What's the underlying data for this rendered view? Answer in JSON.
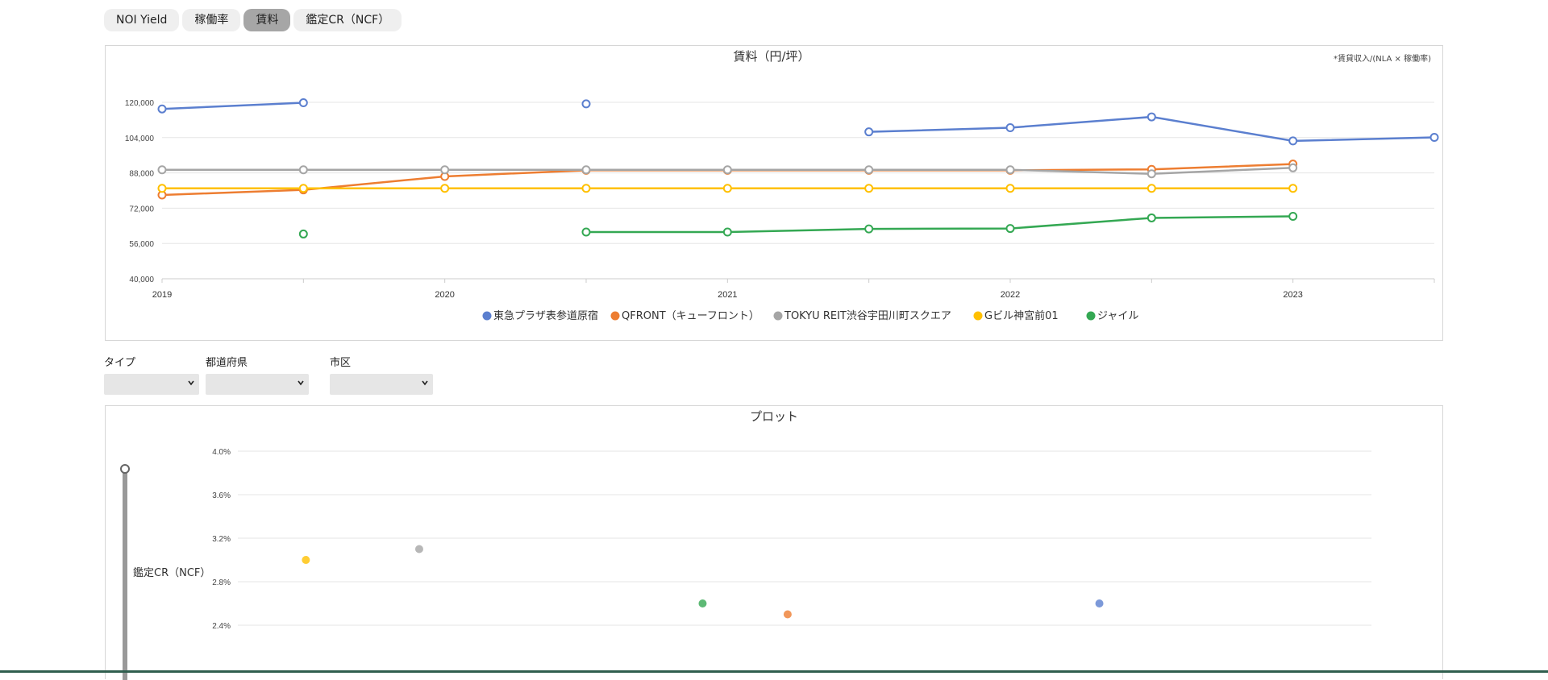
{
  "tabs": [
    {
      "label": "NOI Yield",
      "active": false
    },
    {
      "label": "稼働率",
      "active": false
    },
    {
      "label": "賃料",
      "active": true
    },
    {
      "label": "鑑定CR（NCF）",
      "active": false
    }
  ],
  "filters": {
    "type_label": "タイプ",
    "prefecture_label": "都道府県",
    "city_label": "市区"
  },
  "colors": {
    "blue": "#5b7fcf",
    "orange": "#ed7d31",
    "gray": "#a5a5a5",
    "yellow": "#ffc000",
    "green": "#34a853"
  },
  "chart_data": [
    {
      "type": "line",
      "title": "賃料（円/坪）",
      "note": "*賃貸収入/(NLA × 稼働率)",
      "x_ticks": [
        "2019",
        "2020",
        "2021",
        "2022",
        "2023"
      ],
      "xlim": [
        2019,
        2023.5
      ],
      "ylim": [
        40000,
        120000
      ],
      "y_ticks": [
        40000,
        56000,
        72000,
        88000,
        104000,
        120000
      ],
      "y_tick_labels": [
        "40,000",
        "56,000",
        "72,000",
        "88,000",
        "104,000",
        "120,000"
      ],
      "grid": true,
      "legend_position": "bottom",
      "series": [
        {
          "name": "東急プラザ表参道原宿",
          "color": "#5b7fcf",
          "points": [
            [
              2019,
              117000
            ],
            [
              2019.5,
              119800
            ],
            [
              2020.5,
              119300
            ],
            [
              2021.5,
              106600
            ],
            [
              2022,
              108500
            ],
            [
              2022.5,
              113400
            ],
            [
              2023,
              102500
            ],
            [
              2023.5,
              104100
            ]
          ],
          "breaks_after": [
            1,
            2
          ]
        },
        {
          "name": "QFRONT（キューフロント）",
          "color": "#ed7d31",
          "points": [
            [
              2019,
              78000
            ],
            [
              2019.5,
              80300
            ],
            [
              2020,
              86400
            ],
            [
              2020.5,
              89200
            ],
            [
              2021,
              89200
            ],
            [
              2021.5,
              89200
            ],
            [
              2022,
              89200
            ],
            [
              2022.5,
              89600
            ],
            [
              2023,
              92000
            ]
          ],
          "breaks_after": []
        },
        {
          "name": "TOKYU REIT渋谷宇田川町スクエア",
          "color": "#a5a5a5",
          "points": [
            [
              2019,
              89400
            ],
            [
              2019.5,
              89400
            ],
            [
              2020,
              89400
            ],
            [
              2020.5,
              89400
            ],
            [
              2021,
              89400
            ],
            [
              2021.5,
              89400
            ],
            [
              2022,
              89400
            ],
            [
              2022.5,
              87600
            ],
            [
              2023,
              90300
            ]
          ],
          "breaks_after": []
        },
        {
          "name": "Gビル神宮前01",
          "color": "#ffc000",
          "points": [
            [
              2019,
              81000
            ],
            [
              2019.5,
              81000
            ],
            [
              2020,
              81000
            ],
            [
              2020.5,
              81000
            ],
            [
              2021,
              81000
            ],
            [
              2021.5,
              81000
            ],
            [
              2022,
              81000
            ],
            [
              2022.5,
              81000
            ],
            [
              2023,
              81000
            ]
          ],
          "breaks_after": []
        },
        {
          "name": "ジャイル",
          "color": "#34a853",
          "points": [
            [
              2019.5,
              60300
            ],
            [
              2020.5,
              61200
            ],
            [
              2021,
              61200
            ],
            [
              2021.5,
              62600
            ],
            [
              2022,
              62800
            ],
            [
              2022.5,
              67600
            ],
            [
              2023,
              68300
            ]
          ],
          "breaks_after": [
            0
          ]
        }
      ]
    },
    {
      "type": "scatter",
      "title": "プロット",
      "ylabel": "鑑定CR（NCF）",
      "ylim": [
        2.2,
        4.0
      ],
      "y_ticks": [
        2.4,
        2.8,
        3.2,
        3.6,
        4.0
      ],
      "y_tick_labels": [
        "2.4%",
        "2.8%",
        "3.2%",
        "3.6%",
        "4.0%"
      ],
      "grid": true,
      "slider_value": 1.0,
      "points": [
        {
          "series": "Gビル神宮前01",
          "color": "#ffc000",
          "x": 0.06,
          "y": 3.0
        },
        {
          "series": "TOKYU REIT渋谷宇田川町スクエア",
          "color": "#a5a5a5",
          "x": 0.16,
          "y": 3.1
        },
        {
          "series": "ジャイル",
          "color": "#34a853",
          "x": 0.41,
          "y": 2.6
        },
        {
          "series": "QFRONT（キューフロント）",
          "color": "#ed7d31",
          "x": 0.485,
          "y": 2.5
        },
        {
          "series": "東急プラザ表参道原宿",
          "color": "#5b7fcf",
          "x": 0.76,
          "y": 2.6
        }
      ]
    }
  ]
}
